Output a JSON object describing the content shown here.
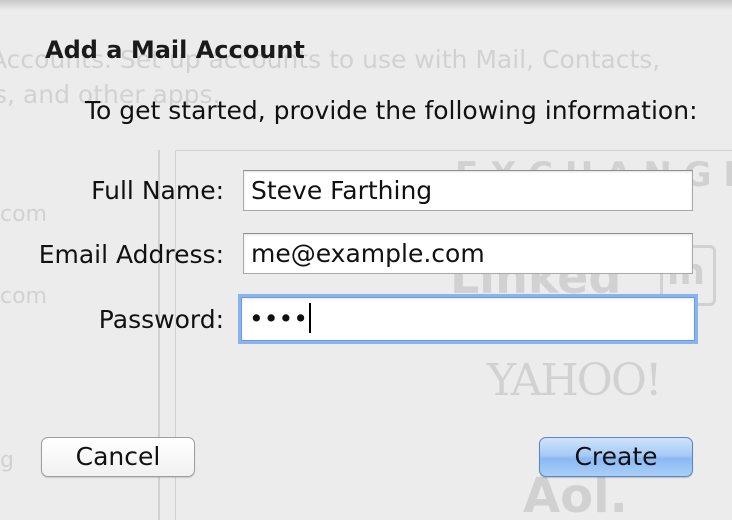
{
  "sheet": {
    "title": "Add a Mail Account",
    "subtitle": "To get started, provide the following information:"
  },
  "form": {
    "full_name": {
      "label": "Full Name:",
      "value": "Steve Farthing"
    },
    "email": {
      "label": "Email Address:",
      "value": "me@example.com"
    },
    "password": {
      "label": "Password:",
      "value": "••••"
    }
  },
  "buttons": {
    "cancel_label": "Cancel",
    "create_label": "Create"
  },
  "background": {
    "line1": "Accounts. Set up accounts to use with Mail, Contacts,",
    "line2": "s, and other apps.",
    "side_item1": "com",
    "side_item2": "com",
    "side_item3": "g",
    "logo_exchange": "E X C H A N G E",
    "logo_linkedin": "Linked",
    "logo_linkedin_in": "in",
    "logo_yahoo": "YAHOO!",
    "logo_aol": "Aol."
  },
  "colors": {
    "sheet_background": "#ececec",
    "focus_ring": "#8bb4ee",
    "default_button": "#8ab9f3"
  }
}
